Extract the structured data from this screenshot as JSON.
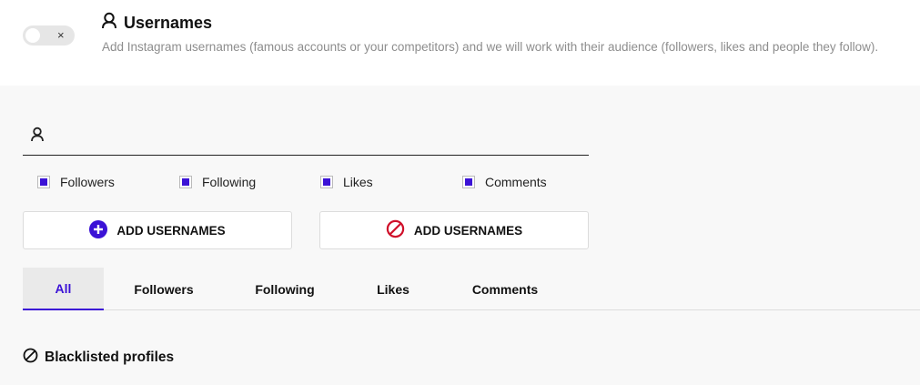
{
  "header": {
    "title": "Usernames",
    "description": "Add Instagram usernames (famous accounts or your competitors) and we will work with their audience (followers, likes and people they follow).",
    "toggle_off_symbol": "×",
    "toggle_state": "off"
  },
  "input": {
    "value": "",
    "placeholder": ""
  },
  "checkboxes": [
    {
      "label": "Followers",
      "checked": true
    },
    {
      "label": "Following",
      "checked": true
    },
    {
      "label": "Likes",
      "checked": true
    },
    {
      "label": "Comments",
      "checked": true
    }
  ],
  "buttons": {
    "add_label": "ADD USERNAMES",
    "block_label": "ADD USERNAMES"
  },
  "tabs": [
    {
      "label": "All",
      "active": true
    },
    {
      "label": "Followers",
      "active": false
    },
    {
      "label": "Following",
      "active": false
    },
    {
      "label": "Likes",
      "active": false
    },
    {
      "label": "Comments",
      "active": false
    }
  ],
  "blacklist": {
    "title": "Blacklisted profiles"
  },
  "colors": {
    "accent": "#3b12d6",
    "danger": "#d0112b"
  },
  "icons": {
    "title": "user-icon",
    "input": "user-icon",
    "add": "plus-circle-icon",
    "block": "block-icon",
    "blacklist": "block-icon"
  }
}
